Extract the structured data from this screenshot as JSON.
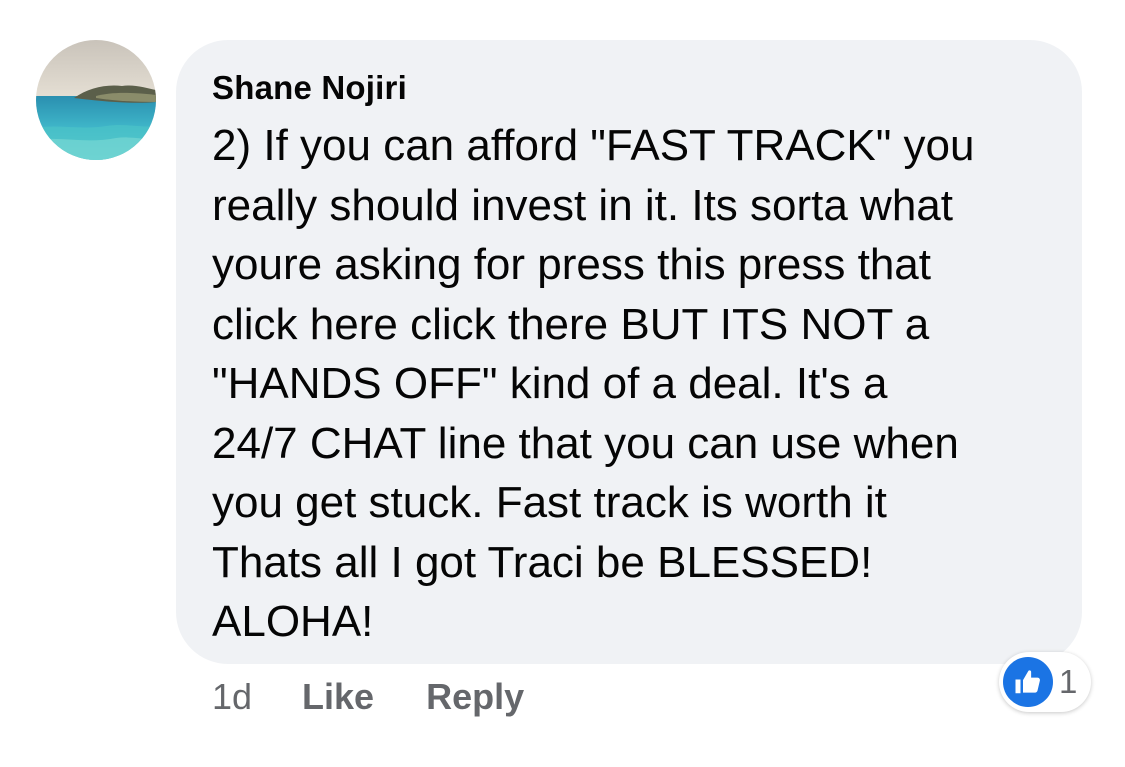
{
  "comment": {
    "author": "Shane Nojiri",
    "lines": [
      "2) If you can afford \"FAST TRACK\" you",
      "really should invest in it. Its sorta what",
      "youre asking for press this press that",
      "click here click there BUT ITS NOT a",
      "\"HANDS OFF\" kind of a deal. It's a",
      "24/7 CHAT line that you can use when",
      "you get stuck. Fast track is worth it",
      "Thats all I got Traci be BLESSED!",
      "ALOHA!"
    ],
    "avatar": "ocean-coastline-photo"
  },
  "actions": {
    "time": "1d",
    "like_label": "Like",
    "reply_label": "Reply"
  },
  "reactions": {
    "icon": "thumbs-up-icon",
    "count": "1",
    "color": "#1b74e4"
  },
  "colors": {
    "bubble": "#f0f2f5",
    "text": "#050505",
    "secondary": "#65676b"
  }
}
